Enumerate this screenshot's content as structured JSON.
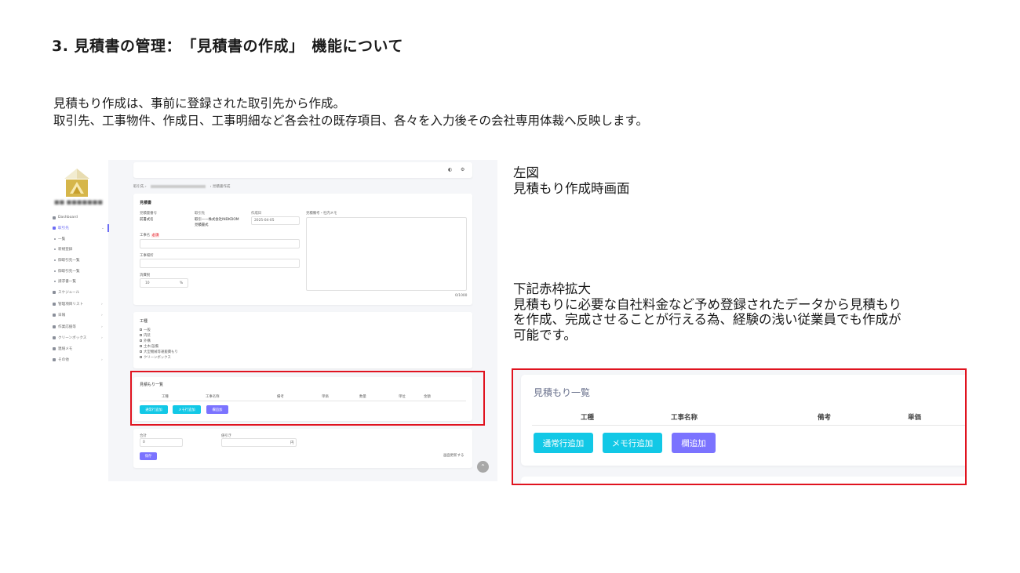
{
  "slide": {
    "title": "3.  見積書の管理：　「見積書の作成」　機能について",
    "intro": [
      "見積もり作成は、事前に登録された取引先から作成。",
      "取引先、工事物件、作成日、工事明細など各会社の既存項目、各々を入力後その会社専用体裁へ反映します。"
    ]
  },
  "screenshot": {
    "sidebar": {
      "items": [
        {
          "label": "Dashboard",
          "icon": "home-icon"
        },
        {
          "label": "取引先",
          "icon": "building-icon"
        },
        {
          "label": "一覧",
          "icon": "bullet-icon"
        },
        {
          "label": "新規登録",
          "icon": "bullet-icon"
        },
        {
          "label": "御取引先一覧",
          "icon": "bullet-icon"
        },
        {
          "label": "御取引先一覧",
          "icon": "bullet-icon"
        },
        {
          "label": "請求書一覧",
          "icon": "bullet-icon"
        },
        {
          "label": "スケジュール",
          "icon": "calendar-icon"
        },
        {
          "label": "管理項目リスト",
          "icon": "chart-icon"
        },
        {
          "label": "日報",
          "icon": "file-icon"
        },
        {
          "label": "作業応援等",
          "icon": "truck-icon"
        },
        {
          "label": "クリーンボックス",
          "icon": "trash-icon"
        },
        {
          "label": "連絡メモ",
          "icon": "message-icon"
        },
        {
          "label": "その他",
          "icon": "gear-icon"
        }
      ]
    },
    "breadcrumb": {
      "first": "取引先",
      "last": "見積書作成"
    },
    "form": {
      "title": "見積書",
      "col1_label": "見積書番号",
      "col1_value": "前書式名",
      "col2_label": "取引先",
      "col2_value_1": "取引——株式会社INDKDOM",
      "col2_value_2": "見積書式",
      "date_label": "作成日",
      "date_value": "2025-04-05",
      "remarks_label": "見積備考・社内メモ",
      "field1_label": "工事名",
      "field1_required": "必須",
      "field2_label": "工事場所",
      "field3_label": "消費税",
      "tax_value": "10",
      "tax_unit": "%",
      "remarks_counter": "0/1000"
    },
    "work": {
      "title": "工種",
      "options": [
        "一般",
        "内装",
        "外構",
        "土木/設備",
        "大型機械等運搬費もり",
        "クリーンボックス"
      ]
    },
    "list": {
      "title": "見積もり一覧",
      "headers": [
        "工種",
        "工事名称",
        "備考",
        "単価",
        "数量",
        "単位",
        "金額"
      ]
    },
    "buttons": {
      "normal": "通常行追加",
      "memo": "メモ行追加",
      "other": "欄追加"
    },
    "bottom": {
      "total_label": "合計",
      "total_value": "0",
      "discount_label": "値引き",
      "discount_unit": "円",
      "save": "保存",
      "link": "画面更新する"
    },
    "scroll_top": "⌃"
  },
  "captions": {
    "left_figure": [
      "左図",
      "見積もり作成時画面"
    ],
    "zoom_note": [
      "下記赤枠拡大",
      "見積もりに必要な自社料金など予め登録されたデータから見積もり",
      "を作成、完成させることが行える為、経験の浅い従業員でも作成が",
      "可能です。"
    ]
  },
  "zoom": {
    "title": "見積もり一覧",
    "headers": [
      "工種",
      "工事名称",
      "備考",
      "単価"
    ],
    "buttons": {
      "normal": "通常行追加",
      "memo": "メモ行追加",
      "other": "欄追加"
    }
  },
  "colors": {
    "accent_cyan": "#12c8e6",
    "accent_purple": "#7b73ff",
    "highlight_red": "#e0131f"
  }
}
